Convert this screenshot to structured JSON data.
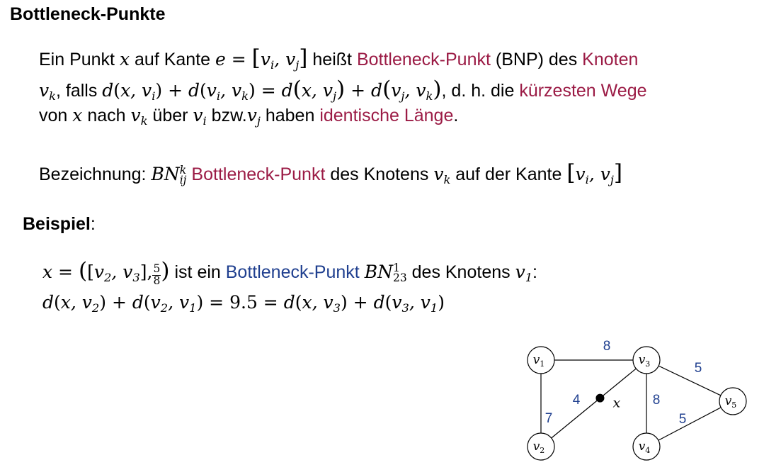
{
  "heading": "Bottleneck-Punkte",
  "definition": {
    "line1": {
      "t1": "Ein Punkt ",
      "x": "x",
      "t2": " auf Kante ",
      "e_eq": "e = ",
      "edge": "v",
      "t3": " heißt ",
      "term": "Bottleneck-Punkt",
      "t4": " (BNP) des ",
      "knoten": "Knoten"
    },
    "line2": {
      "t1": ", falls ",
      "t2": ", d. h. die ",
      "term": "kürzesten Wege"
    },
    "line3": {
      "t1": "von ",
      "t2": " nach ",
      "t3": " über ",
      "t4": " bzw.",
      "t5": "  haben ",
      "term": "identische Länge",
      "t6": "."
    }
  },
  "notation": {
    "label": "Bezeichnung: ",
    "symbol": "BN",
    "sup": "k",
    "sub": "ij",
    "term": "Bottleneck-Punkt",
    "t1": " des Knotens ",
    "t2": " auf der Kante "
  },
  "example": {
    "label": "Beispiel",
    "colon": ":",
    "frac_num": "5",
    "frac_den": "8",
    "t1": " ist ein ",
    "term": "Bottleneck-Punkt",
    "symbol": "BN",
    "sup": "1",
    "sub": "23",
    "t2": " des Knotens ",
    "equation_value": "9.5"
  },
  "graph": {
    "nodes": [
      {
        "id": "v1",
        "label": "v",
        "index": "1"
      },
      {
        "id": "v2",
        "label": "v",
        "index": "2"
      },
      {
        "id": "v3",
        "label": "v",
        "index": "3"
      },
      {
        "id": "v4",
        "label": "v",
        "index": "4"
      },
      {
        "id": "v5",
        "label": "v",
        "index": "5"
      }
    ],
    "edges": [
      {
        "from": "v1",
        "to": "v3",
        "weight": "8"
      },
      {
        "from": "v1",
        "to": "v2",
        "weight": "7"
      },
      {
        "from": "v2",
        "to": "v3",
        "weight": "4"
      },
      {
        "from": "v3",
        "to": "v4",
        "weight": "8"
      },
      {
        "from": "v3",
        "to": "v5",
        "weight": "5"
      },
      {
        "from": "v4",
        "to": "v5",
        "weight": "5"
      }
    ],
    "point_label": "x",
    "weight_color": "#1f3f8f",
    "term_color_red": "#9b1b45",
    "term_color_blue": "#1f3f8f"
  }
}
